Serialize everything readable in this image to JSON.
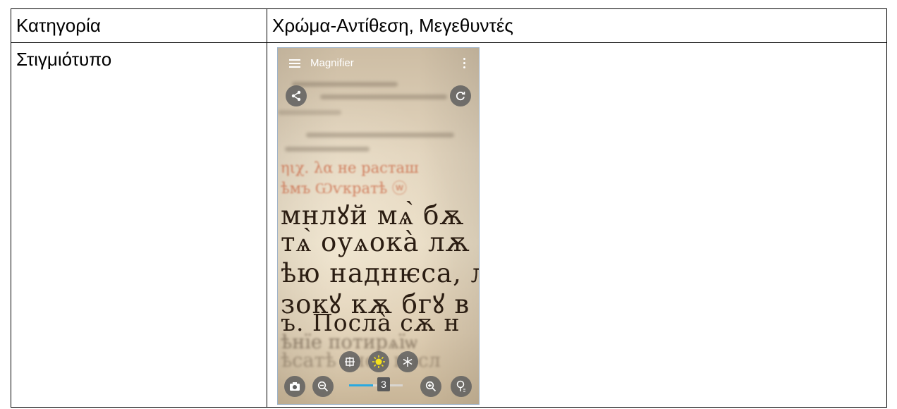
{
  "table": {
    "row1": {
      "label": "Κατηγορία",
      "value": "Χρώμα-Αντίθεση, Μεγεθυντές"
    },
    "row2": {
      "label": "Στιγμιότυπο"
    }
  },
  "screenshot": {
    "app_title": "Magnifier",
    "zoom_level": "3",
    "zoom_fraction": 0.45,
    "accent_color": "#2aa9e0",
    "icons": [
      "menu-icon",
      "more-options-icon",
      "share-icon",
      "refresh-icon",
      "focus-icon",
      "brightness-icon",
      "freeze-icon",
      "camera-icon",
      "zoom-out-icon",
      "zoom-in-icon",
      "flashlight-icon"
    ],
    "page_text": {
      "red_line_1": "ηιχ. λα не расташ",
      "red_line_2": "ѣмъ Ѡѵкратѣ ⓦ",
      "line_1": "мнлꙋй мѧ̀ бѫ",
      "line_2": "тѧ̀ оуѧока̀ лѫ",
      "line_3": "ѣю наднѥса, л",
      "line_4": "зокꙋ кѫ бгꙋ в",
      "line_5": "ъ. Посла̀ сѫ н",
      "line_6": "ѣнїе потирѧїѡ",
      "line_7": "ѣсатѣ гноѧ посл"
    }
  }
}
